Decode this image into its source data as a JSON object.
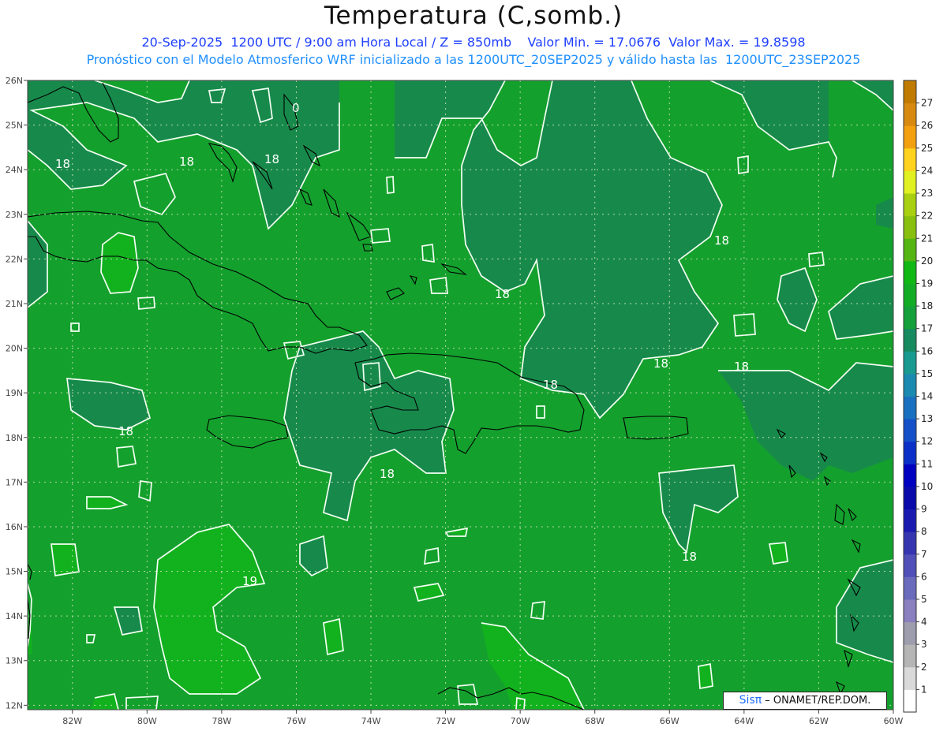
{
  "header": {
    "title": "Temperatura (C,somb.)",
    "line1": "20-Sep-2025  1200 UTC / 9:00 am Hora Local / Z = 850mb    Valor Min. = 17.0676  Valor Max. = 19.8598",
    "line2": "Pronóstico con el Modelo Atmosferico WRF inicializado a las 1200UTC_20SEP2025 y válido hasta las  1200UTC_23SEP2025"
  },
  "map": {
    "lon_range": [
      -83.2,
      -60
    ],
    "lat_range": [
      11.9,
      26.0
    ],
    "lon_ticks": [
      "82W",
      "80W",
      "78W",
      "76W",
      "74W",
      "72W",
      "70W",
      "68W",
      "66W",
      "64W",
      "62W",
      "60W"
    ],
    "lat_ticks": [
      "12N",
      "13N",
      "14N",
      "15N",
      "16N",
      "17N",
      "18N",
      "19N",
      "20N",
      "21N",
      "22N",
      "23N",
      "24N",
      "25N",
      "26N"
    ],
    "contour_labels": [
      "18",
      "18",
      "18",
      "18",
      "18",
      "18",
      "18",
      "18",
      "18",
      "18",
      "18",
      "19",
      "0"
    ],
    "base_color": "#14a02d",
    "cool_color": "#178a4b",
    "warm_color": "#12b21e"
  },
  "colorbar": {
    "values": [
      "1",
      "2",
      "3",
      "4",
      "5",
      "6",
      "7",
      "8",
      "9",
      "10",
      "11",
      "12",
      "13",
      "14",
      "15",
      "16",
      "17",
      "18",
      "19",
      "20",
      "21",
      "22",
      "23",
      "24",
      "25",
      "26",
      "27"
    ],
    "colors": [
      "#ffffff",
      "#d9d9d9",
      "#b5b5b5",
      "#9d9dae",
      "#8a7fbf",
      "#6b6bbd",
      "#5050b8",
      "#3535b0",
      "#1a1ab0",
      "#0a0aaa",
      "#0000c0",
      "#0b30c8",
      "#1450c8",
      "#1a70c0",
      "#1b8ab0",
      "#189a90",
      "#178a60",
      "#14a03a",
      "#12ad25",
      "#10b814",
      "#55b512",
      "#88c010",
      "#a8d010",
      "#e0f020",
      "#ffd21e",
      "#f3a010",
      "#d88a10",
      "#c07a00"
    ]
  },
  "credit": {
    "brand": "Sisπ",
    "text": " – ONAMET/REP.DOM."
  }
}
